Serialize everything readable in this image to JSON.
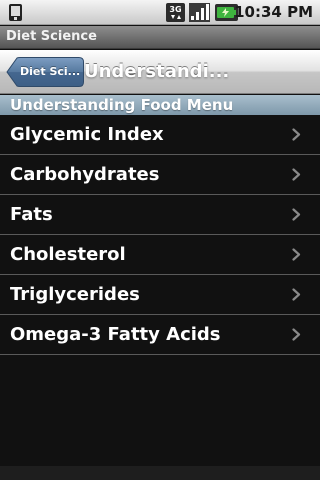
{
  "status_bar": {
    "time": "10:34 PM",
    "network_label": "3G",
    "icons": [
      "notification-icon",
      "3g-data-icon",
      "signal-strength-icon",
      "battery-charging-icon"
    ]
  },
  "app": {
    "title": "Diet Science"
  },
  "nav": {
    "back_label": "Diet Sci...",
    "title": "Understandi..."
  },
  "section": {
    "header": "Understanding Food Menu"
  },
  "menu": {
    "items": [
      {
        "label": "Glycemic Index"
      },
      {
        "label": "Carbohydrates"
      },
      {
        "label": "Fats"
      },
      {
        "label": "Cholesterol"
      },
      {
        "label": "Triglycerides"
      },
      {
        "label": "Omega-3 Fatty Acids"
      }
    ]
  },
  "colors": {
    "nav_accent": "#4d6f96",
    "section_header": "#8fa8b8",
    "list_background": "#111111",
    "battery_green": "#3fb43f"
  }
}
